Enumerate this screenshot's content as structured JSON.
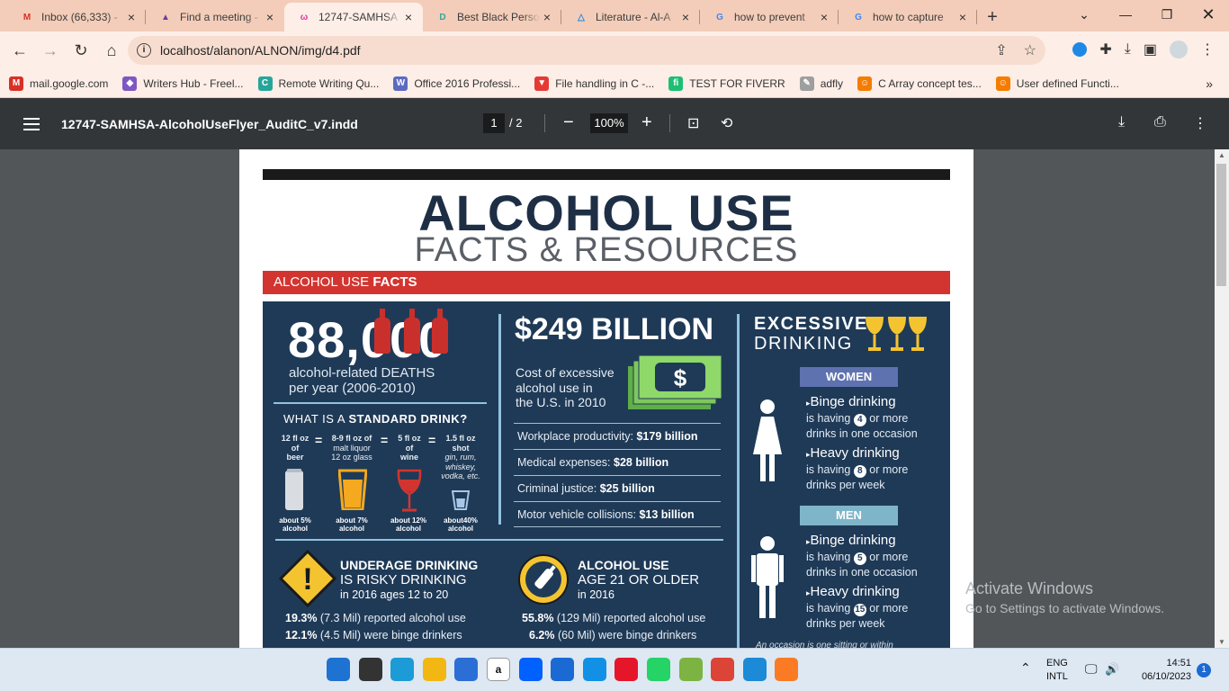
{
  "browser": {
    "tabs": [
      {
        "title": "Inbox (66,333) -",
        "icon": "gmail-icon",
        "icon_text": "M",
        "icon_color": "#d93025"
      },
      {
        "title": "Find a meeting -",
        "icon": "triangle-logo-icon",
        "icon_text": "▲",
        "icon_color": "#6b3fa0"
      },
      {
        "title": "12747-SAMHSA",
        "icon": "pdf-tab-icon",
        "icon_text": "ω",
        "icon_color": "#e0359a",
        "active": true
      },
      {
        "title": "Best Black Perso",
        "icon": "doc-tab-icon",
        "icon_text": "D",
        "icon_color": "#31a89b"
      },
      {
        "title": "Literature - Al-A",
        "icon": "triangle-outline-icon",
        "icon_text": "△",
        "icon_color": "#1e88e5"
      },
      {
        "title": "how to prevent",
        "icon": "google-icon",
        "icon_text": "G",
        "icon_color": "#4285f4"
      },
      {
        "title": "how to capture",
        "icon": "google-icon",
        "icon_text": "G",
        "icon_color": "#4285f4"
      }
    ],
    "close_glyph": "×",
    "new_tab_glyph": "+",
    "url": "localhost/alanon/ALNON/img/d4.pdf",
    "bookmarks": [
      {
        "label": "mail.google.com",
        "icon": "gmail-icon",
        "icon_text": "M",
        "icon_color": "#d93025"
      },
      {
        "label": "Writers Hub - Freel...",
        "icon": "diamond-icon",
        "icon_text": "◆",
        "icon_color": "#7e57c2"
      },
      {
        "label": "Remote Writing Qu...",
        "icon": "c-logo-icon",
        "icon_text": "C",
        "icon_color": "#26a69a"
      },
      {
        "label": "Office 2016 Professi...",
        "icon": "w-logo-icon",
        "icon_text": "W",
        "icon_color": "#5c6bc0"
      },
      {
        "label": "File handling in C -...",
        "icon": "v-logo-icon",
        "icon_text": "▼",
        "icon_color": "#e53935"
      },
      {
        "label": "TEST FOR FIVERR",
        "icon": "fiverr-icon",
        "icon_text": "fi",
        "icon_color": "#1dbf73"
      },
      {
        "label": "adfly",
        "icon": "adfly-icon",
        "icon_text": "✎",
        "icon_color": "#9e9e9e"
      },
      {
        "label": "C Array concept tes...",
        "icon": "quiz-icon",
        "icon_text": "☺",
        "icon_color": "#f57c00"
      },
      {
        "label": "User defined Functi...",
        "icon": "quiz-icon",
        "icon_text": "☺",
        "icon_color": "#f57c00"
      }
    ],
    "more_bookmarks_glyph": "»"
  },
  "pdf_toolbar": {
    "title": "12747-SAMHSA-AlcoholUseFlyer_AuditC_v7.indd",
    "page_current": "1",
    "page_total": "/ 2",
    "zoom": "100%",
    "zoom_out": "−",
    "zoom_in": "+"
  },
  "flyer": {
    "title": "ALCOHOL USE",
    "subtitle": "FACTS & RESOURCES",
    "section_prefix": "ALCOHOL USE ",
    "section_bold": "FACTS",
    "deaths_number": "88,000",
    "deaths_line1": "alcohol-related DEATHS",
    "deaths_line2": "per year (2006-2010)",
    "std_prefix": "WHAT IS A ",
    "std_bold": "STANDARD DRINK?",
    "drinks": [
      {
        "amount": "12 fl oz",
        "l2": "of",
        "l3": "beer",
        "l4": "",
        "pct": "about 5%",
        "pct2": "alcohol"
      },
      {
        "amount": "8-9 fl oz of",
        "l2": "malt liquor",
        "l3": "12 oz glass",
        "l4": "",
        "pct": "about 7%",
        "pct2": "alcohol"
      },
      {
        "amount": "5 fl oz",
        "l2": "of",
        "l3": "wine",
        "l4": "",
        "pct": "about 12%",
        "pct2": "alcohol"
      },
      {
        "amount": "1.5 fl oz",
        "l2": "shot",
        "l3": "gin, rum,",
        "l4": "whiskey,",
        "l5": "vodka, etc.",
        "pct": "about40%",
        "pct2": "alcohol"
      }
    ],
    "equals": "=",
    "cost_title": "$249 BILLION",
    "cost_l1": "Cost of excessive",
    "cost_l2": "alcohol use in",
    "cost_l3": "the U.S. in 2010",
    "money_symbol": "$",
    "costs": [
      {
        "label": "Workplace productivity: ",
        "value": "$179 billion"
      },
      {
        "label": "Medical expenses: ",
        "value": "$28 billion"
      },
      {
        "label": "Criminal justice: ",
        "value": "$25 billion"
      },
      {
        "label": "Motor vehicle collisions: ",
        "value": "$13 billion"
      }
    ],
    "excessive_l1": "EXCESSIVE",
    "excessive_l2": "DRINKING",
    "women_label": "WOMEN",
    "men_label": "MEN",
    "women": {
      "binge_head": "Binge drinking",
      "binge_pre": "is having ",
      "binge_num": "4",
      "binge_post": " or more",
      "binge_l2": "drinks in one occasion",
      "heavy_head": "Heavy drinking",
      "heavy_pre": "is having ",
      "heavy_num": "8",
      "heavy_post": " or more",
      "heavy_l2": "drinks per week"
    },
    "men": {
      "binge_head": "Binge drinking",
      "binge_pre": "is having ",
      "binge_num": "5",
      "binge_post": " or more",
      "binge_l2": "drinks in one occasion",
      "heavy_head": "Heavy drinking",
      "heavy_pre": "is having ",
      "heavy_num": "15",
      "heavy_post": " or more",
      "heavy_l2": "drinks per week"
    },
    "occasion_note": "An occasion is one sitting or within",
    "underage_bold": "UNDERAGE DRINKING",
    "underage_l2": "IS RISKY DRINKING",
    "underage_l3": "in 2016 ages 12 to 20",
    "underage_stats": [
      {
        "pct": "19.3%",
        "text": " (7.3 Mil) reported alcohol use"
      },
      {
        "pct": "12.1%",
        "text": " (4.5 Mil) were binge drinkers"
      }
    ],
    "adult_bold": "ALCOHOL USE",
    "adult_l2": "AGE 21 OR OLDER",
    "adult_l3": "in 2016",
    "adult_stats": [
      {
        "pct": "55.8%",
        "text": " (129 Mil) reported alcohol use"
      },
      {
        "pct": "6.2%",
        "text": " (60 Mil) were binge drinkers"
      }
    ],
    "warning_glyph": "!"
  },
  "watermark": {
    "line1": "Activate Windows",
    "line2": "Go to Settings to activate Windows."
  },
  "taskbar": {
    "lang1": "ENG",
    "lang2": "INTL",
    "time": "14:51",
    "date": "06/10/2023",
    "notif_count": "1",
    "apps": [
      {
        "name": "windows-start-icon",
        "color": "#1e72d2"
      },
      {
        "name": "task-view-icon",
        "color": "#333333"
      },
      {
        "name": "edge-icon",
        "color": "#1d9bd6"
      },
      {
        "name": "file-explorer-icon",
        "color": "#f3b713"
      },
      {
        "name": "store-icon",
        "color": "#2b6fd6"
      },
      {
        "name": "amazon-icon",
        "color": "#ffffff"
      },
      {
        "name": "dropbox-icon",
        "color": "#0061fe"
      },
      {
        "name": "mail-icon",
        "color": "#1b6ad3"
      },
      {
        "name": "power-automate-icon",
        "color": "#1290e6"
      },
      {
        "name": "opera-icon",
        "color": "#e5162a"
      },
      {
        "name": "whatsapp-icon",
        "color": "#25d366"
      },
      {
        "name": "bluestacks-icon",
        "color": "#7cb342"
      },
      {
        "name": "chrome-icon",
        "color": "#db4437"
      },
      {
        "name": "vscode-icon",
        "color": "#1c8ad6"
      },
      {
        "name": "xampp-icon",
        "color": "#fb7a24"
      }
    ],
    "amazon_text": "a"
  }
}
